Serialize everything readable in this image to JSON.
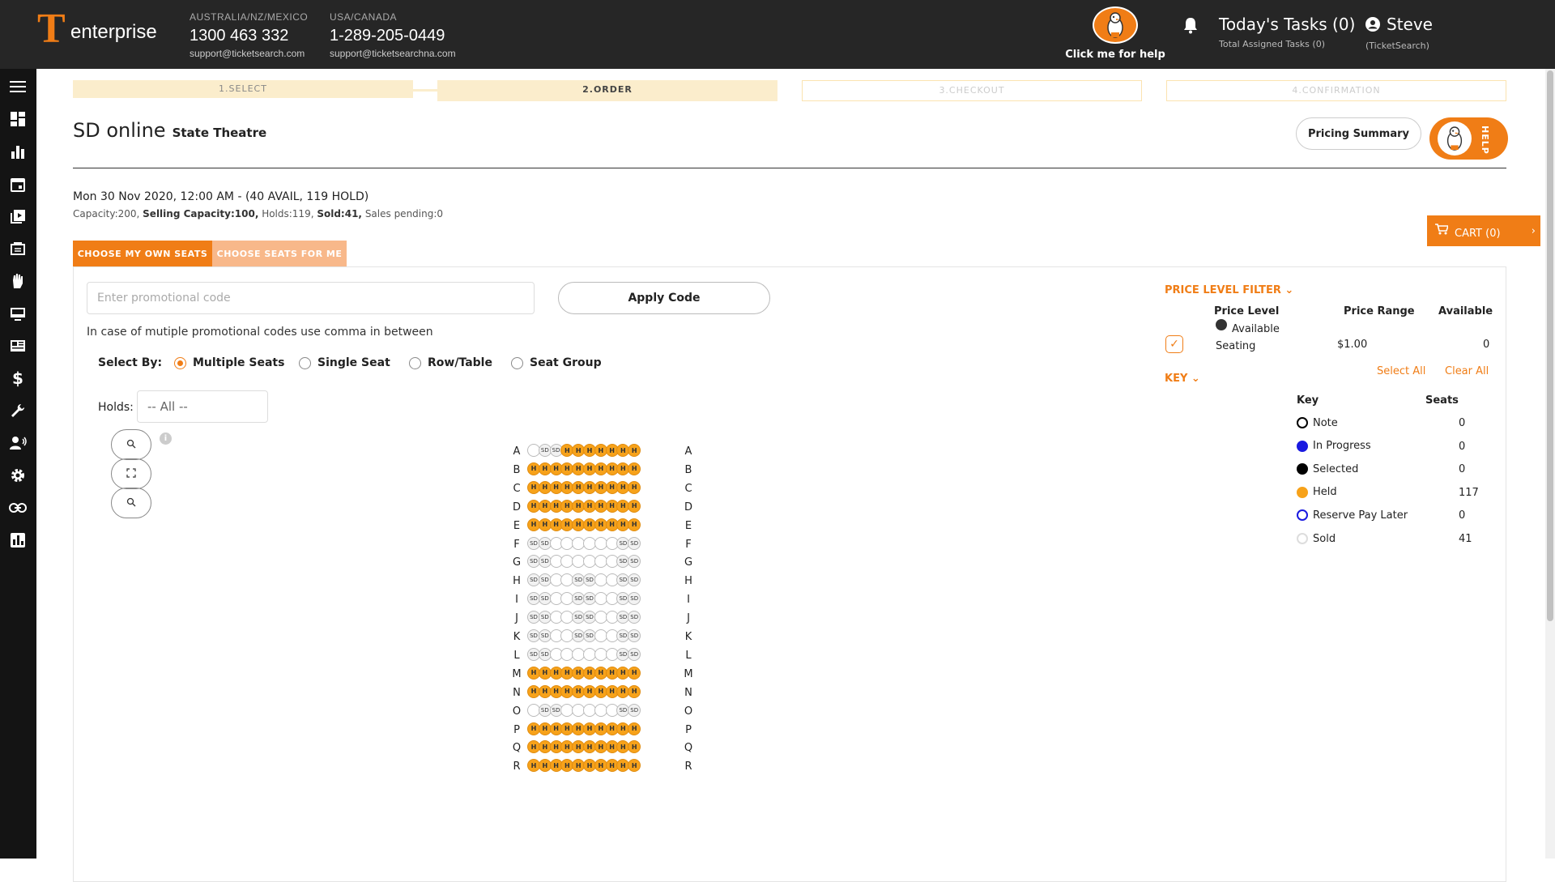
{
  "header": {
    "logo_text": "enterprise",
    "contact": [
      {
        "region": "AUSTRALIA/NZ/MEXICO",
        "phone": "1300 463 332",
        "email": "support@ticketsearch.com"
      },
      {
        "region": "USA/CANADA",
        "phone": "1-289-205-0449",
        "email": "support@ticketsearchna.com"
      }
    ],
    "help_label": "Click me for help",
    "tasks_title": "Today's Tasks (0)",
    "tasks_sub": "Total Assigned Tasks (0)",
    "user_name": "Steve",
    "user_org": "(TicketSearch)"
  },
  "sidebar": {
    "icons": [
      "menu-icon",
      "dashboard-icon",
      "bar-chart-icon",
      "calendar-icon",
      "library-icon",
      "ticket-icon",
      "hand-icon",
      "monitor-icon",
      "news-icon",
      "dollar-icon",
      "wrench-icon",
      "contact-icon",
      "gear-icon",
      "link-icon",
      "analytics-icon"
    ]
  },
  "steps": [
    "1.SELECT",
    "2.ORDER",
    "3.CHECKOUT",
    "4.CONFIRMATION"
  ],
  "event": {
    "title": "SD online",
    "venue": "State Theatre",
    "datetime": "Mon 30 Nov 2020, 12:00 AM - (40 AVAIL, 119 HOLD)",
    "capacity_prefix": "Capacity:200, ",
    "selling_capacity": "Selling Capacity:100,",
    "holds": " Holds:119, ",
    "sold": "Sold:41,",
    "pending": " Sales pending:0"
  },
  "buttons": {
    "pricing_summary": "Pricing Summary",
    "help_vertical": "HELP",
    "cart": "CART (0)",
    "apply_code": "Apply Code"
  },
  "tabs": [
    "CHOOSE MY OWN SEATS",
    "CHOOSE SEATS FOR ME"
  ],
  "promo": {
    "placeholder": "Enter promotional code",
    "note": "In case of mutiple promotional codes use comma in between"
  },
  "select_by": {
    "label": "Select By:",
    "options": [
      "Multiple Seats",
      "Single Seat",
      "Row/Table",
      "Seat Group"
    ],
    "selected": "Multiple Seats"
  },
  "holds": {
    "label": "Holds:",
    "value": "-- All --"
  },
  "seatmap": {
    "rows": [
      {
        "label": "A",
        "seats": [
          "E",
          "SD",
          "SD",
          "H",
          "H",
          "H",
          "H",
          "H",
          "H",
          "H"
        ]
      },
      {
        "label": "B",
        "seats": [
          "H",
          "H",
          "H",
          "H",
          "H",
          "H",
          "H",
          "H",
          "H",
          "H"
        ]
      },
      {
        "label": "C",
        "seats": [
          "H",
          "H",
          "H",
          "H",
          "H",
          "H",
          "H",
          "H",
          "H",
          "H"
        ]
      },
      {
        "label": "D",
        "seats": [
          "H",
          "H",
          "H",
          "H",
          "H",
          "H",
          "H",
          "H",
          "H",
          "H"
        ]
      },
      {
        "label": "E",
        "seats": [
          "H",
          "H",
          "H",
          "H",
          "H",
          "H",
          "H",
          "H",
          "H",
          "H"
        ]
      },
      {
        "label": "F",
        "seats": [
          "SD",
          "SD",
          "E",
          "E",
          "E",
          "E",
          "E",
          "E",
          "SD",
          "SD"
        ]
      },
      {
        "label": "G",
        "seats": [
          "SD",
          "SD",
          "E",
          "E",
          "E",
          "E",
          "E",
          "E",
          "SD",
          "SD"
        ]
      },
      {
        "label": "H",
        "seats": [
          "SD",
          "SD",
          "E",
          "E",
          "SD",
          "SD",
          "E",
          "E",
          "SD",
          "SD"
        ]
      },
      {
        "label": "I",
        "seats": [
          "SD",
          "SD",
          "E",
          "E",
          "SD",
          "SD",
          "E",
          "E",
          "SD",
          "SD"
        ]
      },
      {
        "label": "J",
        "seats": [
          "SD",
          "SD",
          "E",
          "E",
          "SD",
          "SD",
          "E",
          "E",
          "SD",
          "SD"
        ]
      },
      {
        "label": "K",
        "seats": [
          "SD",
          "SD",
          "E",
          "E",
          "SD",
          "SD",
          "E",
          "E",
          "SD",
          "SD"
        ]
      },
      {
        "label": "L",
        "seats": [
          "SD",
          "SD",
          "E",
          "E",
          "E",
          "E",
          "E",
          "E",
          "SD",
          "SD"
        ]
      },
      {
        "label": "M",
        "seats": [
          "H",
          "H",
          "H",
          "H",
          "H",
          "H",
          "H",
          "H",
          "H",
          "H"
        ]
      },
      {
        "label": "N",
        "seats": [
          "H",
          "H",
          "H",
          "H",
          "H",
          "H",
          "H",
          "H",
          "H",
          "H"
        ]
      },
      {
        "label": "O",
        "seats": [
          "E",
          "SD",
          "SD",
          "E",
          "E",
          "E",
          "E",
          "E",
          "SD",
          "SD"
        ]
      },
      {
        "label": "P",
        "seats": [
          "H",
          "H",
          "H",
          "H",
          "H",
          "H",
          "H",
          "H",
          "H",
          "H"
        ]
      },
      {
        "label": "Q",
        "seats": [
          "H",
          "H",
          "H",
          "H",
          "H",
          "H",
          "H",
          "H",
          "H",
          "H"
        ]
      },
      {
        "label": "R",
        "seats": [
          "H",
          "H",
          "H",
          "H",
          "H",
          "H",
          "H",
          "H",
          "H",
          "H"
        ]
      }
    ]
  },
  "price_filter": {
    "title": "PRICE LEVEL FILTER",
    "headers": [
      "Price Level",
      "Price Range",
      "Available"
    ],
    "level_name": "Available Seating",
    "range": "$1.00",
    "available": "0",
    "select_all": "Select All",
    "clear_all": "Clear All"
  },
  "key": {
    "title": "KEY",
    "headers": [
      "Key",
      "Seats"
    ],
    "items": [
      {
        "label": "Note",
        "count": "0",
        "color": "#ffffff",
        "border": "#000000"
      },
      {
        "label": "In Progress",
        "count": "0",
        "color": "#1a1ae0",
        "border": "#1a1ae0"
      },
      {
        "label": "Selected",
        "count": "0",
        "color": "#000000",
        "border": "#000000"
      },
      {
        "label": "Held",
        "count": "117",
        "color": "#f7a21a",
        "border": "#f7a21a"
      },
      {
        "label": "Reserve Pay Later",
        "count": "0",
        "color": "#ffffff",
        "border": "#1a1ae0"
      },
      {
        "label": "Sold",
        "count": "41",
        "color": "#ffffff",
        "border": "#dddddd"
      }
    ]
  },
  "colors": {
    "accent": "#f07d16",
    "held": "#f7a21a",
    "topbar": "#262626"
  }
}
